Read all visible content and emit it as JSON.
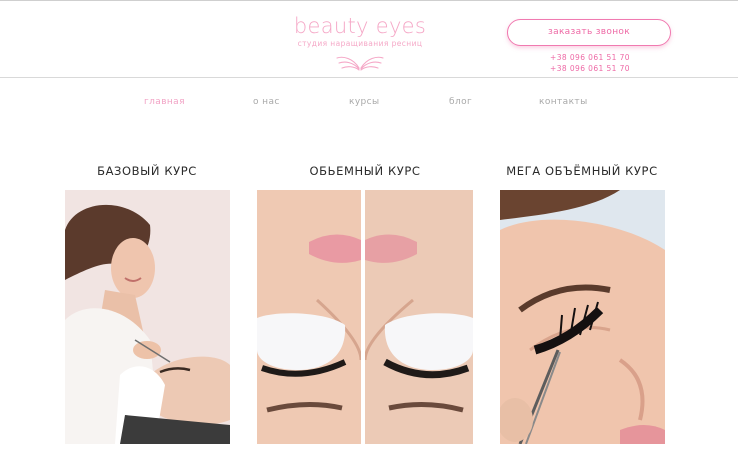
{
  "header": {
    "logo_title": "beauty eyes",
    "logo_subtitle": "студия наращивания ресниц",
    "callback_label": "заказать звонок",
    "phones": [
      "+38 096 061 51 70",
      "+38 096 061 51 70"
    ]
  },
  "nav": {
    "items": [
      {
        "label": "главная",
        "active": true
      },
      {
        "label": "о нас",
        "active": false
      },
      {
        "label": "курсы",
        "active": false
      },
      {
        "label": "блог",
        "active": false
      },
      {
        "label": "контакты",
        "active": false
      }
    ]
  },
  "courses": [
    {
      "title": "БАЗОВЫЙ КУРС"
    },
    {
      "title": "ОБЬЕМНЫЙ КУРС"
    },
    {
      "title": "МЕГА ОБЪЁМНЫЙ КУРС"
    }
  ],
  "colors": {
    "brand_pink": "#f5a8c7",
    "button_pink": "#ee6aa6",
    "nav_gray": "#a9a9a9",
    "title_dark": "#2b2b2b"
  }
}
